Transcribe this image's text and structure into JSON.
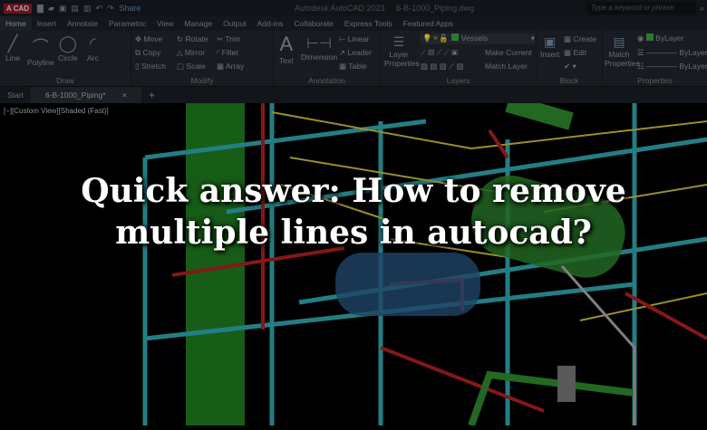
{
  "titlebar": {
    "logo": "A CAD",
    "share": "Share",
    "app_title": "Autodesk AutoCAD 2023",
    "file": "6-B-1000_Piping.dwg",
    "search_placeholder": "Type a keyword or phrase"
  },
  "tabs": [
    "Home",
    "Insert",
    "Annotate",
    "Parametric",
    "View",
    "Manage",
    "Output",
    "Add-ins",
    "Collaborate",
    "Express Tools",
    "Featured Apps"
  ],
  "draw": {
    "label": "Draw",
    "items": [
      "Line",
      "Polyline",
      "Circle",
      "Arc"
    ]
  },
  "modify": {
    "label": "Modify",
    "items": [
      "Move",
      "Rotate",
      "Trim",
      "Copy",
      "Mirror",
      "Fillet",
      "Stretch",
      "Scale",
      "Array"
    ]
  },
  "annotation": {
    "label": "Annotation",
    "items": [
      "Text",
      "Dimension",
      "Linear",
      "Leader",
      "Table"
    ]
  },
  "layers": {
    "label": "Layers",
    "layer_properties": "Layer Properties",
    "current_layer": "Vessels",
    "make_current": "Make Current",
    "match_layer": "Match Layer",
    "layer_color": "#3fa045"
  },
  "block": {
    "label": "Block",
    "insert": "Insert",
    "create": "Create",
    "edit": "Edit"
  },
  "properties": {
    "label": "Properties",
    "match": "Match Properties",
    "color": "ByLayer",
    "linetype": "ByLayer",
    "lineweight": "ByLayer"
  },
  "doctabs": {
    "start": "Start",
    "current": "6-B-1000_Piping*",
    "close": "×",
    "add": "+"
  },
  "viewport": {
    "label": "[−][Custom View][Shaded (Fast)]"
  },
  "headline": {
    "line1": "Quick answer: How to remove",
    "line2": "multiple lines in autocad?"
  }
}
